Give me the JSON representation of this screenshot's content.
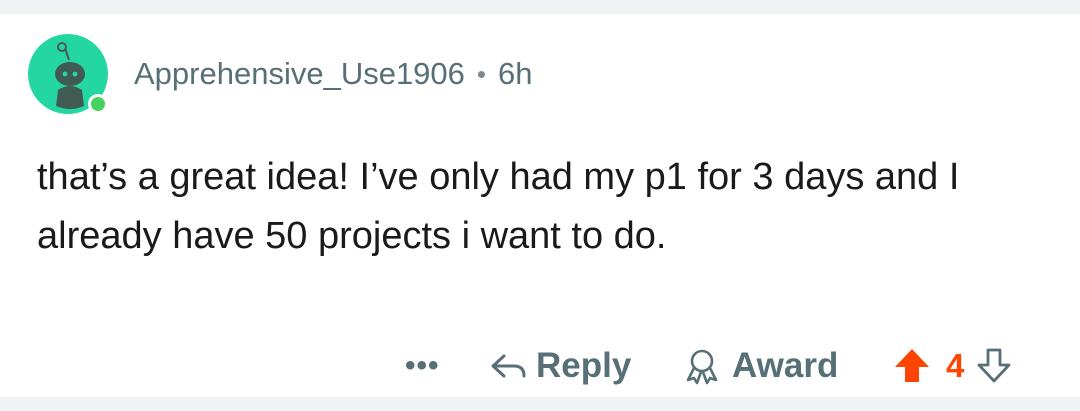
{
  "comment": {
    "author": "Apprehensive_Use1906",
    "separator": "•",
    "age": "6h",
    "body": "that’s a great idea! I’ve only had my p1 for 3 days and I already have 50 projects i want to do."
  },
  "actions": {
    "more_label": "•••",
    "reply_label": "Reply",
    "award_label": "Award",
    "vote_count": "4"
  },
  "icons": {
    "avatar": "reddit-snoo-avatar",
    "online": "online-status-dot",
    "reply": "reply-arrow-icon",
    "award": "award-ribbon-icon",
    "upvote": "upvote-arrow-icon",
    "downvote": "downvote-arrow-icon"
  },
  "colors": {
    "avatar_bg": "#24d6a2",
    "online": "#46d160",
    "upvote_active": "#ff4500",
    "meta_text": "#576f76",
    "body_text": "#1a1a1b"
  }
}
